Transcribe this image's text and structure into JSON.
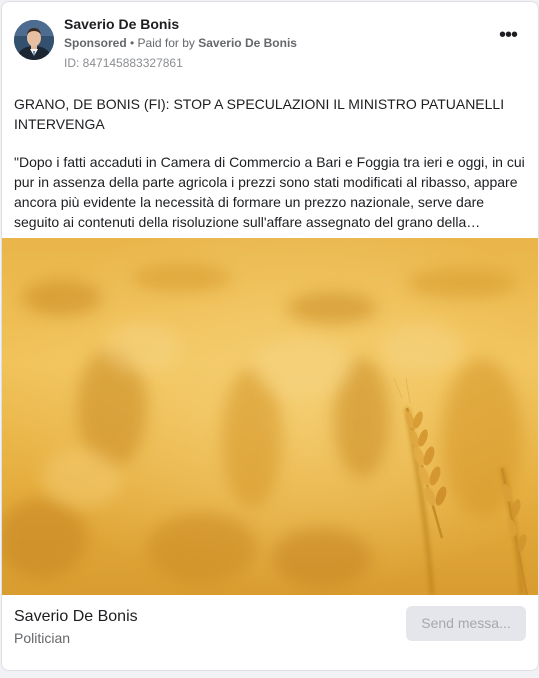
{
  "ad": {
    "page_name": "Saverio De Bonis",
    "sponsored_label": "Sponsored",
    "separator": " • ",
    "paid_for_prefix": "Paid for by ",
    "paid_for_name": "Saverio De Bonis",
    "ad_id": "ID: 847145883327861",
    "more_icon": "more-options-icon",
    "title": "GRANO, DE BONIS (FI): STOP A SPECULAZIONI IL MINISTRO PATUANELLI INTERVENGA",
    "body": "\"Dopo i fatti accaduti in Camera di Commercio a Bari e Foggia tra ieri e oggi, in cui pur in assenza della parte agricola i prezzi sono stati modificati al ribasso, appare ancora più evidente la necessità di formare un prezzo nazionale, serve dare seguito ai contenuti della risoluzione sull'affare assegnato del grano della…"
  },
  "footer": {
    "page_name": "Saverio De Bonis",
    "category": "Politician",
    "cta_label": "Send messa..."
  },
  "colors": {
    "primary_text": "#1c1e21",
    "secondary_text": "#65676b",
    "button_bg": "#e4e6eb",
    "button_text": "#a6a8ac",
    "wheat": "#e0a93a"
  }
}
